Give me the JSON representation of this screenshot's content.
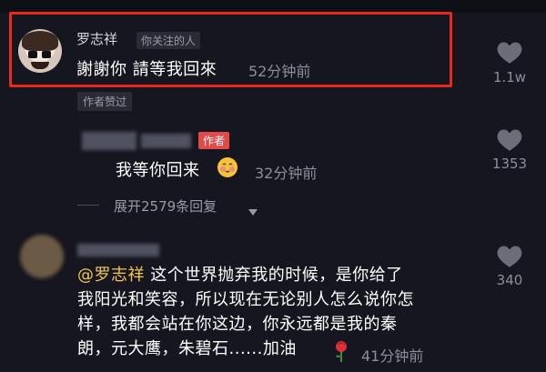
{
  "comment1": {
    "username": "罗志祥",
    "follow_tag": "你关注的人",
    "text": "謝謝你 請等我回來",
    "time": "52分钟前",
    "likes": "1.1w",
    "author_liked": "作者赞过"
  },
  "comment2": {
    "author_tag": "作者",
    "text": "我等你回来",
    "emoji": "blushing-face-emoji",
    "time": "32分钟前",
    "likes": "1353",
    "expand_label": "展开2579条回复",
    "expand_icon": "triangle-down-icon"
  },
  "comment3": {
    "mention": "@罗志祥",
    "line1": " 这个世界抛弃我的时候，是你给了",
    "line2": "我阳光和笑容，所以现在无论别人怎么说你怎",
    "line3": "样，我都会站在你这边，你永远都是我的秦",
    "line4": "朗，元大鹰，朱碧石......加油",
    "emoji": "rose-emoji",
    "time": "41分钟前",
    "likes": "340"
  },
  "colors": {
    "background": "#15161f",
    "highlight_border": "#e8291c",
    "author_tag": "#e24a4a",
    "mention": "#f0c94c"
  }
}
